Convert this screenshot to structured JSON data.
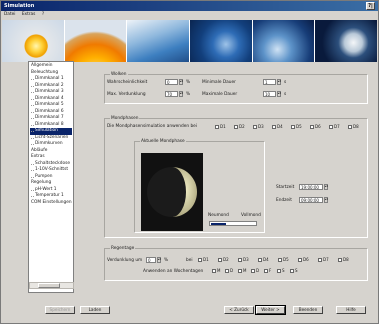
{
  "window": {
    "title": "Simulation",
    "help": "?|"
  },
  "menu": [
    "Datei",
    "Extras",
    "?"
  ],
  "tree": [
    {
      "label": "Allgemein",
      "level": 1
    },
    {
      "label": "Beleuchtung",
      "level": 1
    },
    {
      "label": "Dimmkanal 1",
      "level": 2
    },
    {
      "label": "Dimmkanal 2",
      "level": 2
    },
    {
      "label": "Dimmkanal 3",
      "level": 2
    },
    {
      "label": "Dimmkanal 4",
      "level": 2
    },
    {
      "label": "Dimmkanal 5",
      "level": 2
    },
    {
      "label": "Dimmkanal 6",
      "level": 2
    },
    {
      "label": "Dimmkanal 7",
      "level": 2
    },
    {
      "label": "Dimmkanal 8",
      "level": 2
    },
    {
      "label": "Simulation",
      "level": 2,
      "selected": true
    },
    {
      "label": "Licht-Szenarien",
      "level": 2
    },
    {
      "label": "Dimmkurven",
      "level": 2
    },
    {
      "label": "Abläufe",
      "level": 1
    },
    {
      "label": "Extras",
      "level": 1
    },
    {
      "label": "Schaltsteckdose",
      "level": 2
    },
    {
      "label": "1-10V-Schnittst",
      "level": 2
    },
    {
      "label": "Pumpen",
      "level": 2
    },
    {
      "label": "Regelung",
      "level": 1
    },
    {
      "label": "pH-Wert 1",
      "level": 2
    },
    {
      "label": "Temperatur 1",
      "level": 2
    },
    {
      "label": "COM Einstellungen",
      "level": 1
    }
  ],
  "wolken": {
    "caption": "Wolken",
    "wahrscheinlichkeit_label": "Wahrscheinlichkeit",
    "wahrscheinlichkeit_value": "0",
    "verdunklung_label": "Max. Verdunklung",
    "verdunklung_value": "70",
    "percent": "%",
    "min_dauer_label": "Minimale Dauer",
    "min_dauer_value": "1",
    "max_dauer_label": "Maximale Dauer",
    "max_dauer_value": "10",
    "unit_s": "s"
  },
  "mondphasen": {
    "caption": "Mondphasen",
    "anwenden_label": "Die Mondphasensimulation anwenden bei",
    "channels": [
      "D1",
      "D2",
      "D3",
      "D4",
      "D5",
      "D6",
      "D7",
      "D8"
    ],
    "aktuelle_caption": "Aktuelle Mondphase",
    "neumond": "Neumond",
    "vollmond": "Vollmond",
    "progress": 0.33,
    "startzeit_label": "Startzeit",
    "startzeit_value": "19:00:00",
    "endzeit_label": "Endzeit",
    "endzeit_value": "09:00:00"
  },
  "regentage": {
    "caption": "Regentage",
    "verdunklung_label": "Verdunklung um",
    "verdunklung_value": "0",
    "percent": "%",
    "bei_label": "bei",
    "channels": [
      "D1",
      "D2",
      "D3",
      "D4",
      "D5",
      "D6",
      "D7",
      "D8"
    ],
    "wochentage_label": "Anwenden an Wochentagen",
    "days": [
      "M",
      "D",
      "M",
      "D",
      "F",
      "S",
      "S"
    ]
  },
  "footer": {
    "speichern": "Speichern",
    "laden": "Laden",
    "zurueck": "< Zurück",
    "weiter": "Weiter >",
    "beenden": "Beenden",
    "hilfe": "Hilfe"
  }
}
